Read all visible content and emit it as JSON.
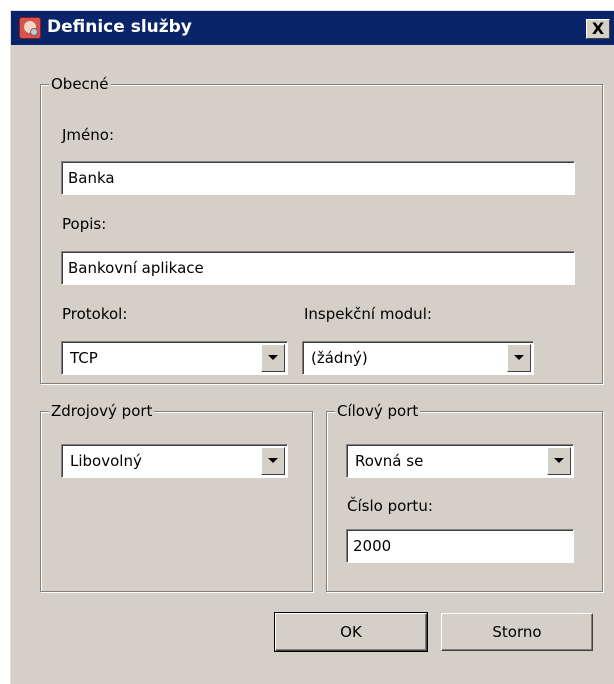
{
  "window": {
    "title": "Definice služby",
    "close_label": "X"
  },
  "general": {
    "legend": "Obecné",
    "name_label": "Jméno:",
    "name_value": "Banka",
    "description_label": "Popis:",
    "description_value": "Bankovní aplikace",
    "protocol_label": "Protokol:",
    "protocol_value": "TCP",
    "inspection_label": "Inspekční modul:",
    "inspection_value": "(žádný)"
  },
  "source_port": {
    "legend": "Zdrojový port",
    "mode_value": "Libovolný"
  },
  "dest_port": {
    "legend": "Cílový port",
    "mode_value": "Rovná se",
    "port_label": "Číslo portu:",
    "port_value": "2000"
  },
  "buttons": {
    "ok": "OK",
    "cancel": "Storno"
  },
  "colors": {
    "titlebar": "#0a246a",
    "dialog_face": "#d4d0c8"
  },
  "icons": {
    "app": "service-definition-icon",
    "close": "close-icon",
    "dropdown": "chevron-down-icon"
  }
}
